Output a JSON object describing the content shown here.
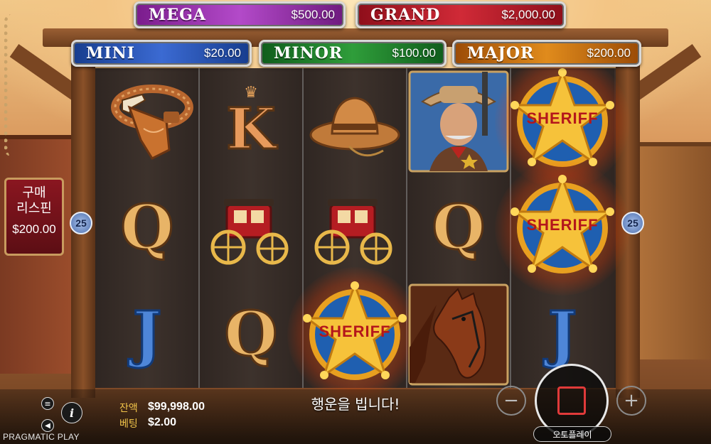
{
  "jackpots": {
    "mega": {
      "name": "MEGA",
      "amount": "$500.00",
      "color": "#b34ac9"
    },
    "grand": {
      "name": "GRAND",
      "amount": "$2,000.00",
      "color": "#d02a37"
    },
    "mini": {
      "name": "MINI",
      "amount": "$20.00",
      "color": "#3b6ad2"
    },
    "minor": {
      "name": "MINOR",
      "amount": "$100.00",
      "color": "#2f9d3a"
    },
    "major": {
      "name": "MAJOR",
      "amount": "$200.00",
      "color": "#e08b1c"
    }
  },
  "buy_respin": {
    "label_line1": "구매",
    "label_line2": "리스핀",
    "price": "$200.00"
  },
  "paylines": {
    "left": "25",
    "right": "25"
  },
  "reels": [
    [
      "gun-belt",
      "Q",
      "J"
    ],
    [
      "K",
      "stagecoach",
      "Q"
    ],
    [
      "cowboy-hat",
      "stagecoach",
      "sheriff-badge"
    ],
    [
      "sheriff-portrait",
      "Q",
      "horse"
    ],
    [
      "sheriff-badge",
      "sheriff-badge",
      "J"
    ]
  ],
  "symbols": {
    "K": "K",
    "Q": "Q",
    "J": "J",
    "sheriff_text": "SHERIFF"
  },
  "footer": {
    "balance_label": "잔액",
    "balance_value": "$99,998.00",
    "bet_label": "베팅",
    "bet_value": "$2.00",
    "message": "행운을 빕니다!",
    "brand": "PRAGMATIC PLAY",
    "autoplay_label": "오토플레이",
    "info": "i",
    "minus": "−",
    "plus": "+"
  }
}
